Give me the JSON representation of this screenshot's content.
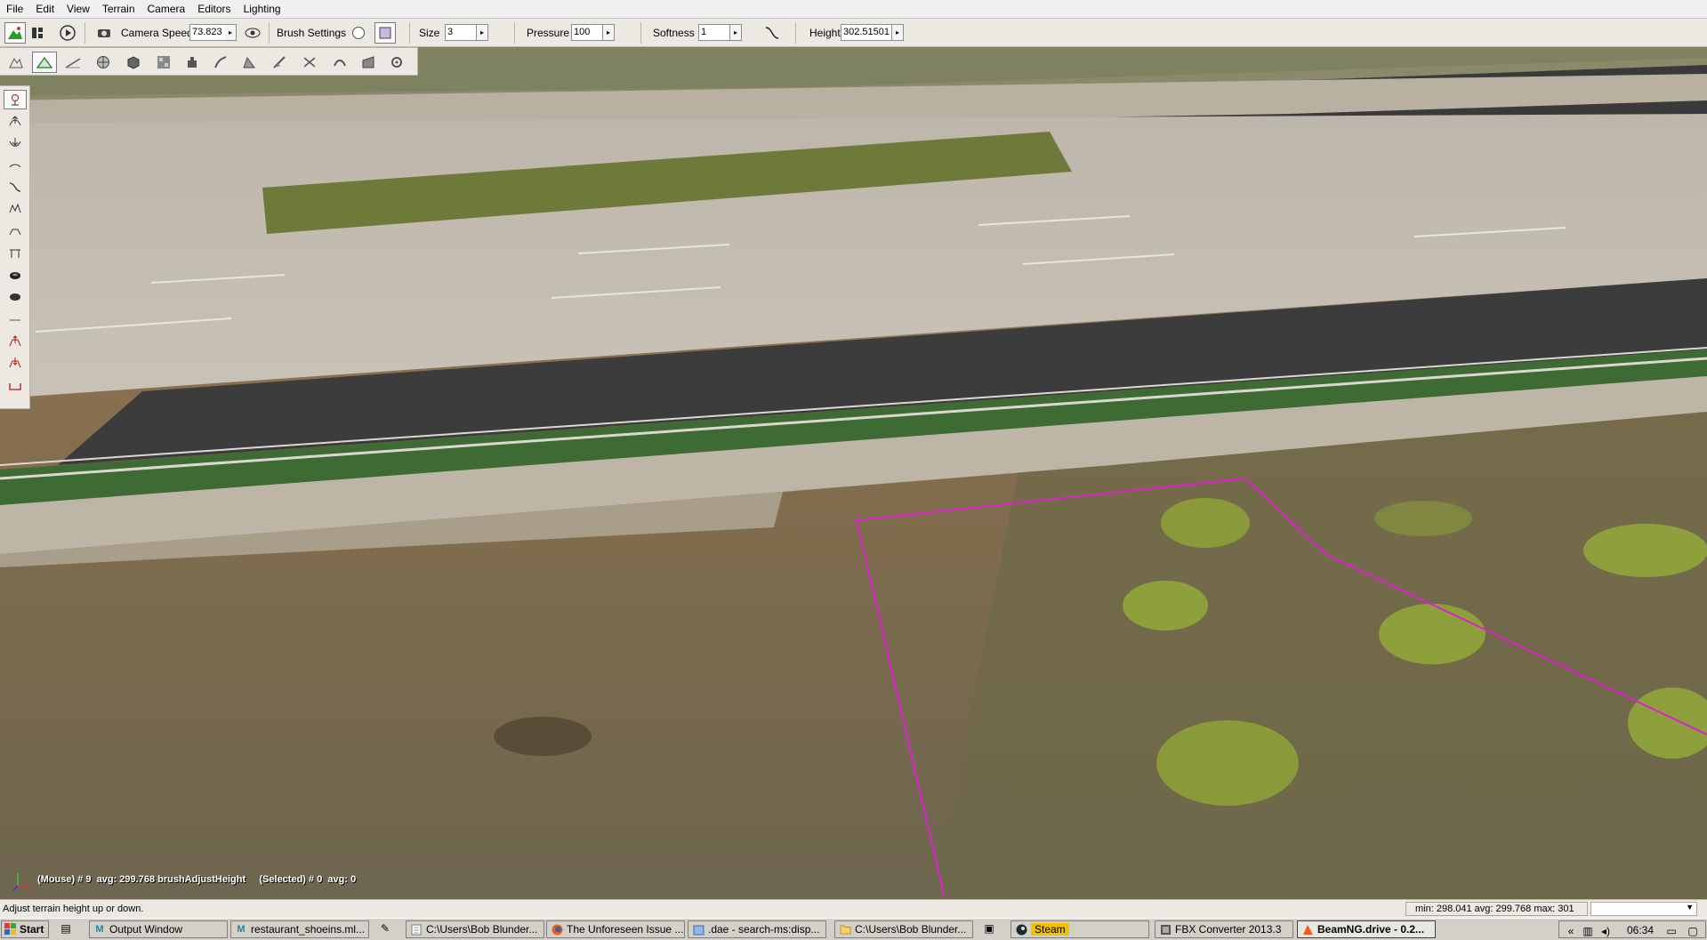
{
  "menu": [
    "File",
    "Edit",
    "View",
    "Terrain",
    "Camera",
    "Editors",
    "Lighting"
  ],
  "toolbar": {
    "camera_speed_label": "Camera Speed",
    "camera_speed_value": "73.823",
    "brush_settings_label": "Brush Settings",
    "size_label": "Size",
    "size_value": "3",
    "pressure_label": "Pressure",
    "pressure_value": "100",
    "softness_label": "Softness",
    "softness_value": "1",
    "height_label": "Height",
    "height_value": "302.51501"
  },
  "terrain_tools": [
    "terrain-overview-icon",
    "raise-height-icon",
    "smooth-icon",
    "globe-icon",
    "box-icon",
    "paint-material-icon",
    "adjust-icon",
    "flatten-icon",
    "slope-icon",
    "noise-icon",
    "cut-icon",
    "erode-icon",
    "ramp-icon",
    "settings-icon"
  ],
  "palette_tools": [
    "select-icon",
    "raise-icon",
    "lower-icon",
    "smooth-line-icon",
    "curve-icon",
    "noise-icon",
    "flatten-icon",
    "set-height-icon",
    "paint-hole-icon",
    "clear-hole-icon",
    "line-icon",
    "raise-red-icon",
    "lower-red-icon",
    "terrace-icon"
  ],
  "viewport": {
    "hud": "(Mouse) # 9  avg: 299.768 brushAdjustHeight     (Selected) # 0  avg: 0",
    "accent_color": "#e020d0"
  },
  "status": {
    "message": "Adjust terrain height up or down.",
    "stats": "min: 298.041  avg: 299.768  max: 301"
  },
  "taskbar": {
    "start": "Start",
    "tasks": [
      {
        "label": "Output Window",
        "icon": "M"
      },
      {
        "label": "restaurant_shoeins.ml...",
        "icon": "M"
      },
      {
        "label": "C:\\Users\\Bob Blunder...",
        "icon": "notepad"
      },
      {
        "label": "The Unforeseen Issue ...",
        "icon": "firefox"
      },
      {
        "label": ".dae - search-ms:disp...",
        "icon": "search"
      },
      {
        "label": "C:\\Users\\Bob Blunder...",
        "icon": "folder"
      },
      {
        "label": "Steam",
        "icon": "steam"
      },
      {
        "label": "FBX Converter 2013.3",
        "icon": "fbx"
      },
      {
        "label": "BeamNG.drive - 0.2...",
        "icon": "beamng"
      }
    ],
    "clock": "06:34"
  }
}
